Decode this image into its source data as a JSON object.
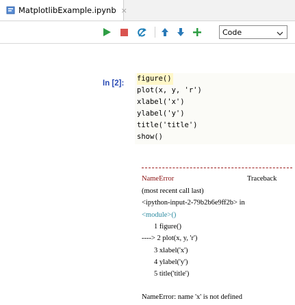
{
  "tab": {
    "filename": "MatplotlibExample.ipynb",
    "close": "×",
    "icon": "notebook-icon"
  },
  "toolbar": {
    "buttons": [
      "run-icon",
      "stop-icon",
      "restart-icon",
      "move-up-icon",
      "move-down-icon",
      "add-cell-icon"
    ],
    "cell_type": "Code",
    "colors": {
      "run": "#2e9e44",
      "stop": "#d9534f",
      "restart": "#1e7fb8",
      "arrows": "#2a7ab8"
    }
  },
  "cell": {
    "prompt": "In [2]:",
    "code": [
      "figure()",
      "plot(x, y, 'r')",
      "xlabel('x')",
      "ylabel('y')",
      "title('title')",
      "show()"
    ]
  },
  "output": {
    "error_name": "NameError",
    "traceback_label": "Traceback",
    "recent": "(most recent call last)",
    "location": "<ipython-input-2-79b2b6e9ff2b> in",
    "module": "<module>()",
    "lines": [
      "1 figure()",
      "----> 2 plot(x, y, 'r')",
      "3 xlabel('x')",
      "4 ylabel('y')",
      "5 title('title')"
    ],
    "message": "NameError: name 'x' is not defined"
  }
}
